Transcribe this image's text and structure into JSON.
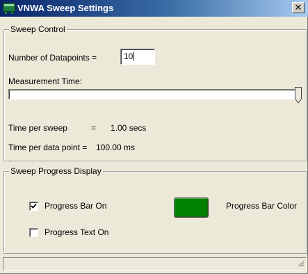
{
  "window": {
    "title": "VNWA Sweep Settings",
    "close_glyph": "✕"
  },
  "sweep_control": {
    "group_title": "Sweep Control",
    "datapoints_label": "Number of Datapoints =",
    "datapoints_value": "10",
    "measurement_time_label": "Measurement Time:",
    "measurement_time_slider_fraction": 1.0,
    "time_per_sweep_label": "Time per sweep",
    "time_per_sweep_eq": "=",
    "time_per_sweep_value": "1.00 secs",
    "time_per_point_label": "Time per data point =",
    "time_per_point_value": "100.00 ms"
  },
  "sweep_progress": {
    "group_title": "Sweep Progress Display",
    "progress_bar_label": "Progress Bar On",
    "progress_bar_checked": true,
    "progress_text_label": "Progress Text On",
    "progress_text_checked": false,
    "progress_bar_color_label": "Progress Bar Color",
    "progress_bar_color": "#008000"
  },
  "colors": {
    "title_bar": "#0a246a",
    "face": "#ece9d8"
  },
  "icons": {
    "app": "app-window-icon",
    "close": "close-icon",
    "check": "check-icon",
    "grip": "resize-grip-icon"
  }
}
